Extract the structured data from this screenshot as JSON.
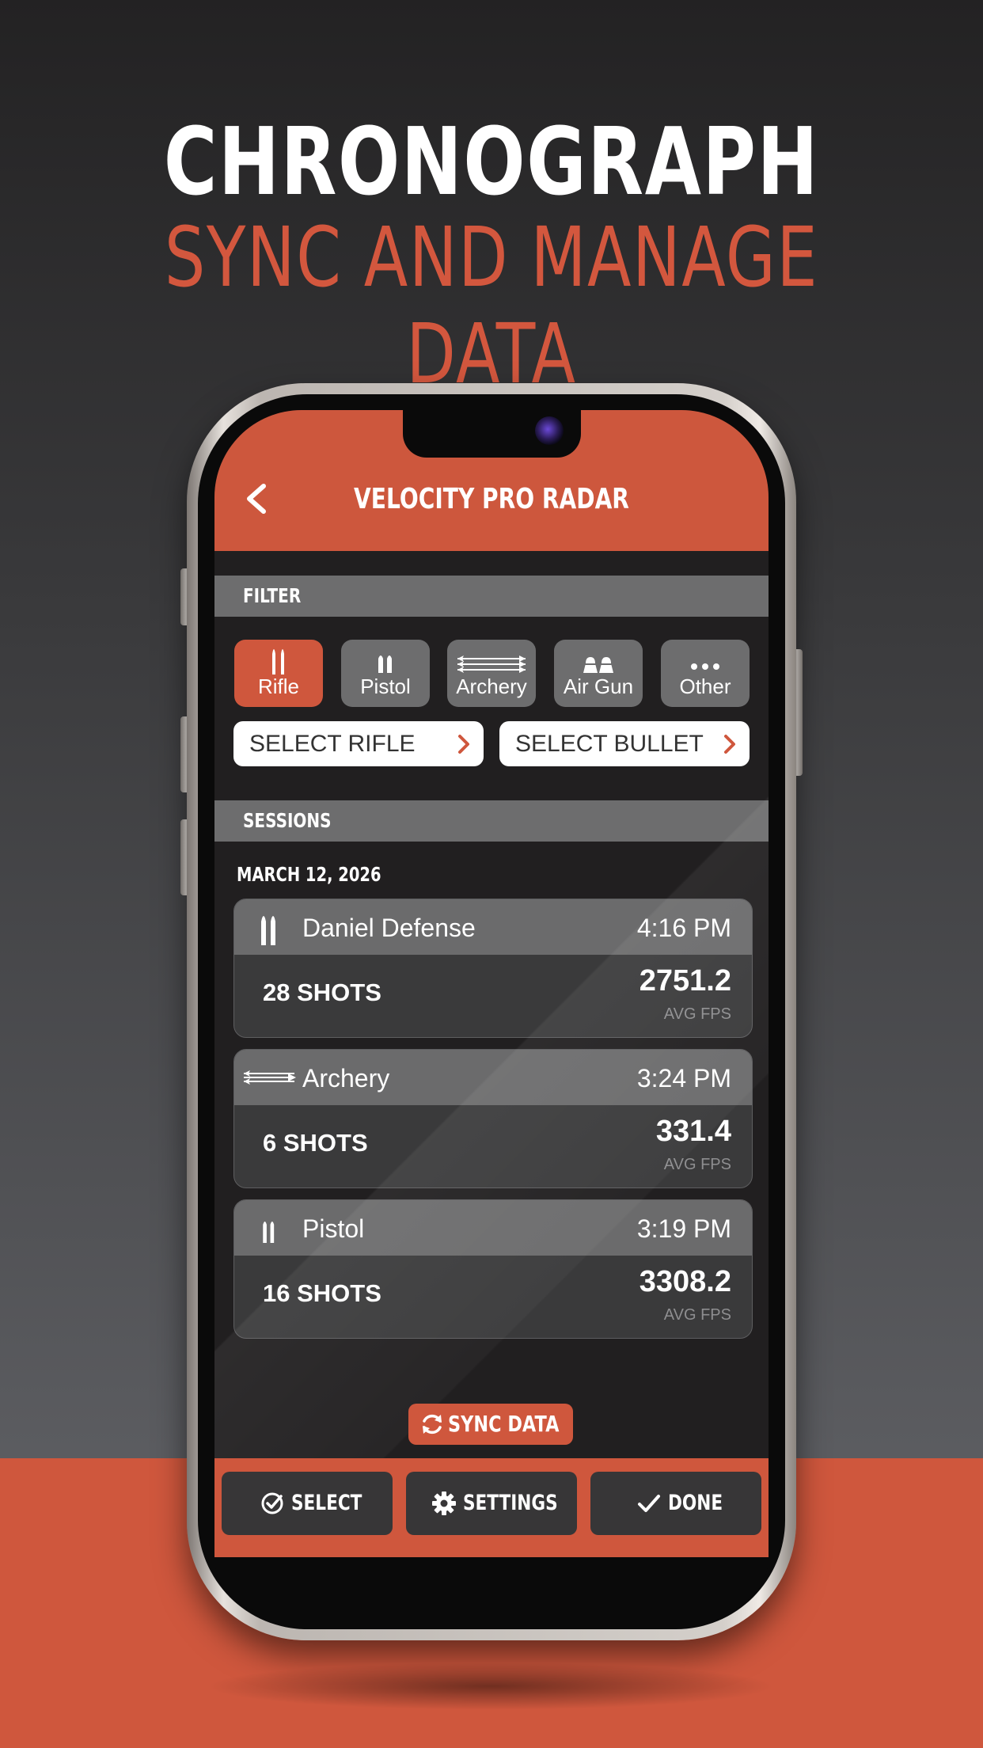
{
  "marketing": {
    "headline": "CHRONOGRAPH",
    "subheadline": "SYNC AND MANAGE DATA"
  },
  "app": {
    "title": "VELOCITY PRO RADAR",
    "back_icon": "chevron-left-icon"
  },
  "filter": {
    "section_label": "FILTER",
    "categories": [
      {
        "label": "Rifle",
        "icon": "rifle-cartridge-icon",
        "active": true
      },
      {
        "label": "Pistol",
        "icon": "pistol-cartridge-icon",
        "active": false
      },
      {
        "label": "Archery",
        "icon": "arrows-icon",
        "active": false
      },
      {
        "label": "Air Gun",
        "icon": "pellet-icon",
        "active": false
      },
      {
        "label": "Other",
        "icon": "ellipsis-icon",
        "active": false
      }
    ],
    "select_rifle": "SELECT RIFLE",
    "select_bullet": "SELECT BULLET"
  },
  "sessions": {
    "section_label": "SESSIONS",
    "date": "MARCH 12, 2026",
    "items": [
      {
        "name": "Daniel Defense",
        "time": "4:16 PM",
        "shots": "28 SHOTS",
        "avg_fps": "2751.2",
        "fps_label": "AVG FPS",
        "icon": "rifle-cartridge-icon"
      },
      {
        "name": "Archery",
        "time": "3:24 PM",
        "shots": "6 SHOTS",
        "avg_fps": "331.4",
        "fps_label": "AVG FPS",
        "icon": "arrows-icon"
      },
      {
        "name": "Pistol",
        "time": "3:19 PM",
        "shots": "16 SHOTS",
        "avg_fps": "3308.2",
        "fps_label": "AVG FPS",
        "icon": "pistol-cartridge-icon"
      }
    ]
  },
  "sync": {
    "label": "SYNC DATA",
    "icon": "refresh-icon"
  },
  "toolbar": {
    "select_label": "SELECT",
    "settings_label": "SETTINGS",
    "done_label": "DONE"
  },
  "colors": {
    "accent": "#cf573d",
    "screen_bg": "#211f20",
    "section_bg": "#6d6d6e",
    "card_bg": "#3a3a3b"
  }
}
